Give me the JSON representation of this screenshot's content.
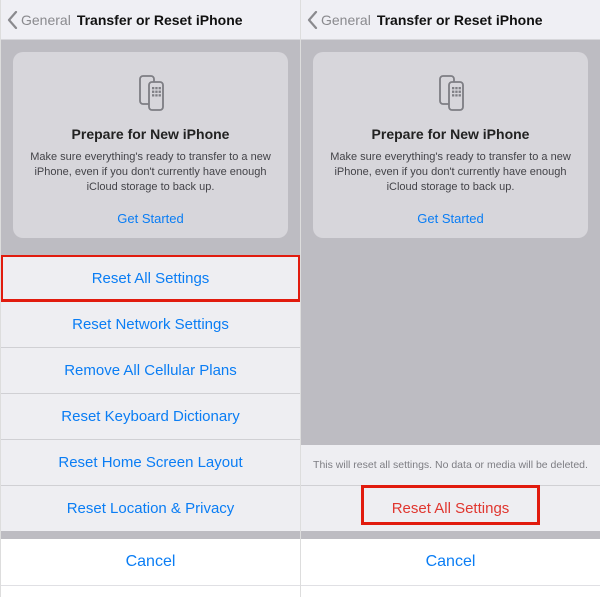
{
  "left": {
    "nav": {
      "back_label": "General",
      "title": "Transfer or Reset iPhone"
    },
    "card": {
      "heading": "Prepare for New iPhone",
      "description": "Make sure everything's ready to transfer to a new iPhone, even if you don't currently have enough iCloud storage to back up.",
      "cta": "Get Started"
    },
    "sheet": {
      "items": [
        "Reset All Settings",
        "Reset Network Settings",
        "Remove All Cellular Plans",
        "Reset Keyboard Dictionary",
        "Reset Home Screen Layout",
        "Reset Location & Privacy"
      ],
      "highlighted_index": 0,
      "cancel": "Cancel"
    }
  },
  "right": {
    "nav": {
      "back_label": "General",
      "title": "Transfer or Reset iPhone"
    },
    "card": {
      "heading": "Prepare for New iPhone",
      "description": "Make sure everything's ready to transfer to a new iPhone, even if you don't currently have enough iCloud storage to back up.",
      "cta": "Get Started"
    },
    "confirm": {
      "message": "This will reset all settings. No data or media will be deleted.",
      "action": "Reset All Settings",
      "cancel": "Cancel"
    }
  }
}
